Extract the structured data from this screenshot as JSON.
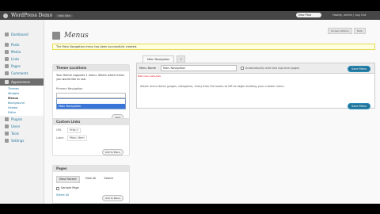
{
  "admin_bar": {
    "site_name": "WordPress Demo",
    "site_link": "Visit Site",
    "new_draft": "New Post",
    "howdy": "Howdy, admin | Log Out"
  },
  "header_buttons": {
    "screen_options": "Screen Options",
    "help": "Help"
  },
  "sidebar": {
    "top_items": [
      {
        "label": "Dashboard"
      }
    ],
    "content_items": [
      {
        "label": "Posts"
      },
      {
        "label": "Media"
      },
      {
        "label": "Links"
      },
      {
        "label": "Pages"
      },
      {
        "label": "Comments"
      }
    ],
    "appearance": {
      "label": "Appearance",
      "submenu": [
        "Themes",
        "Widgets",
        "Menus",
        "Background",
        "Header",
        "Editor"
      ],
      "current": "Menus"
    },
    "bottom_items": [
      {
        "label": "Plugins"
      },
      {
        "label": "Users"
      },
      {
        "label": "Tools"
      },
      {
        "label": "Settings"
      }
    ]
  },
  "page": {
    "title": "Menus",
    "notice": "The Main Navigation menu has been successfully created."
  },
  "theme_locations": {
    "title": "Theme Locations",
    "description": "Your theme supports 1 menu. Select which menu you would like to use.",
    "label": "Primary Navigation",
    "selected": "",
    "option_highlighted": "Main Navigation",
    "save_button": "Save"
  },
  "custom_links": {
    "title": "Custom Links",
    "url_label": "URL",
    "url_value": "http://",
    "label_label": "Label",
    "label_value": "Menu Item",
    "add_button": "Add to Menu"
  },
  "pages_box": {
    "title": "Pages",
    "tabs": [
      "Most Recent",
      "View All",
      "Search"
    ],
    "item": "Sample Page",
    "select_all": "Select All",
    "add_button": "Add to Menu"
  },
  "editor": {
    "tab_active": "Main Navigation",
    "tab_plus": "+",
    "menu_name_label": "Menu Name",
    "menu_name_value": "Main Navigation",
    "auto_add": "Automatically add new top-level pages",
    "save_menu": "Save Menu",
    "hint": "Select menu items (pages, categories, links) from the boxes at left to begin building your custom menu.",
    "red_note": "Enter menu name here"
  }
}
